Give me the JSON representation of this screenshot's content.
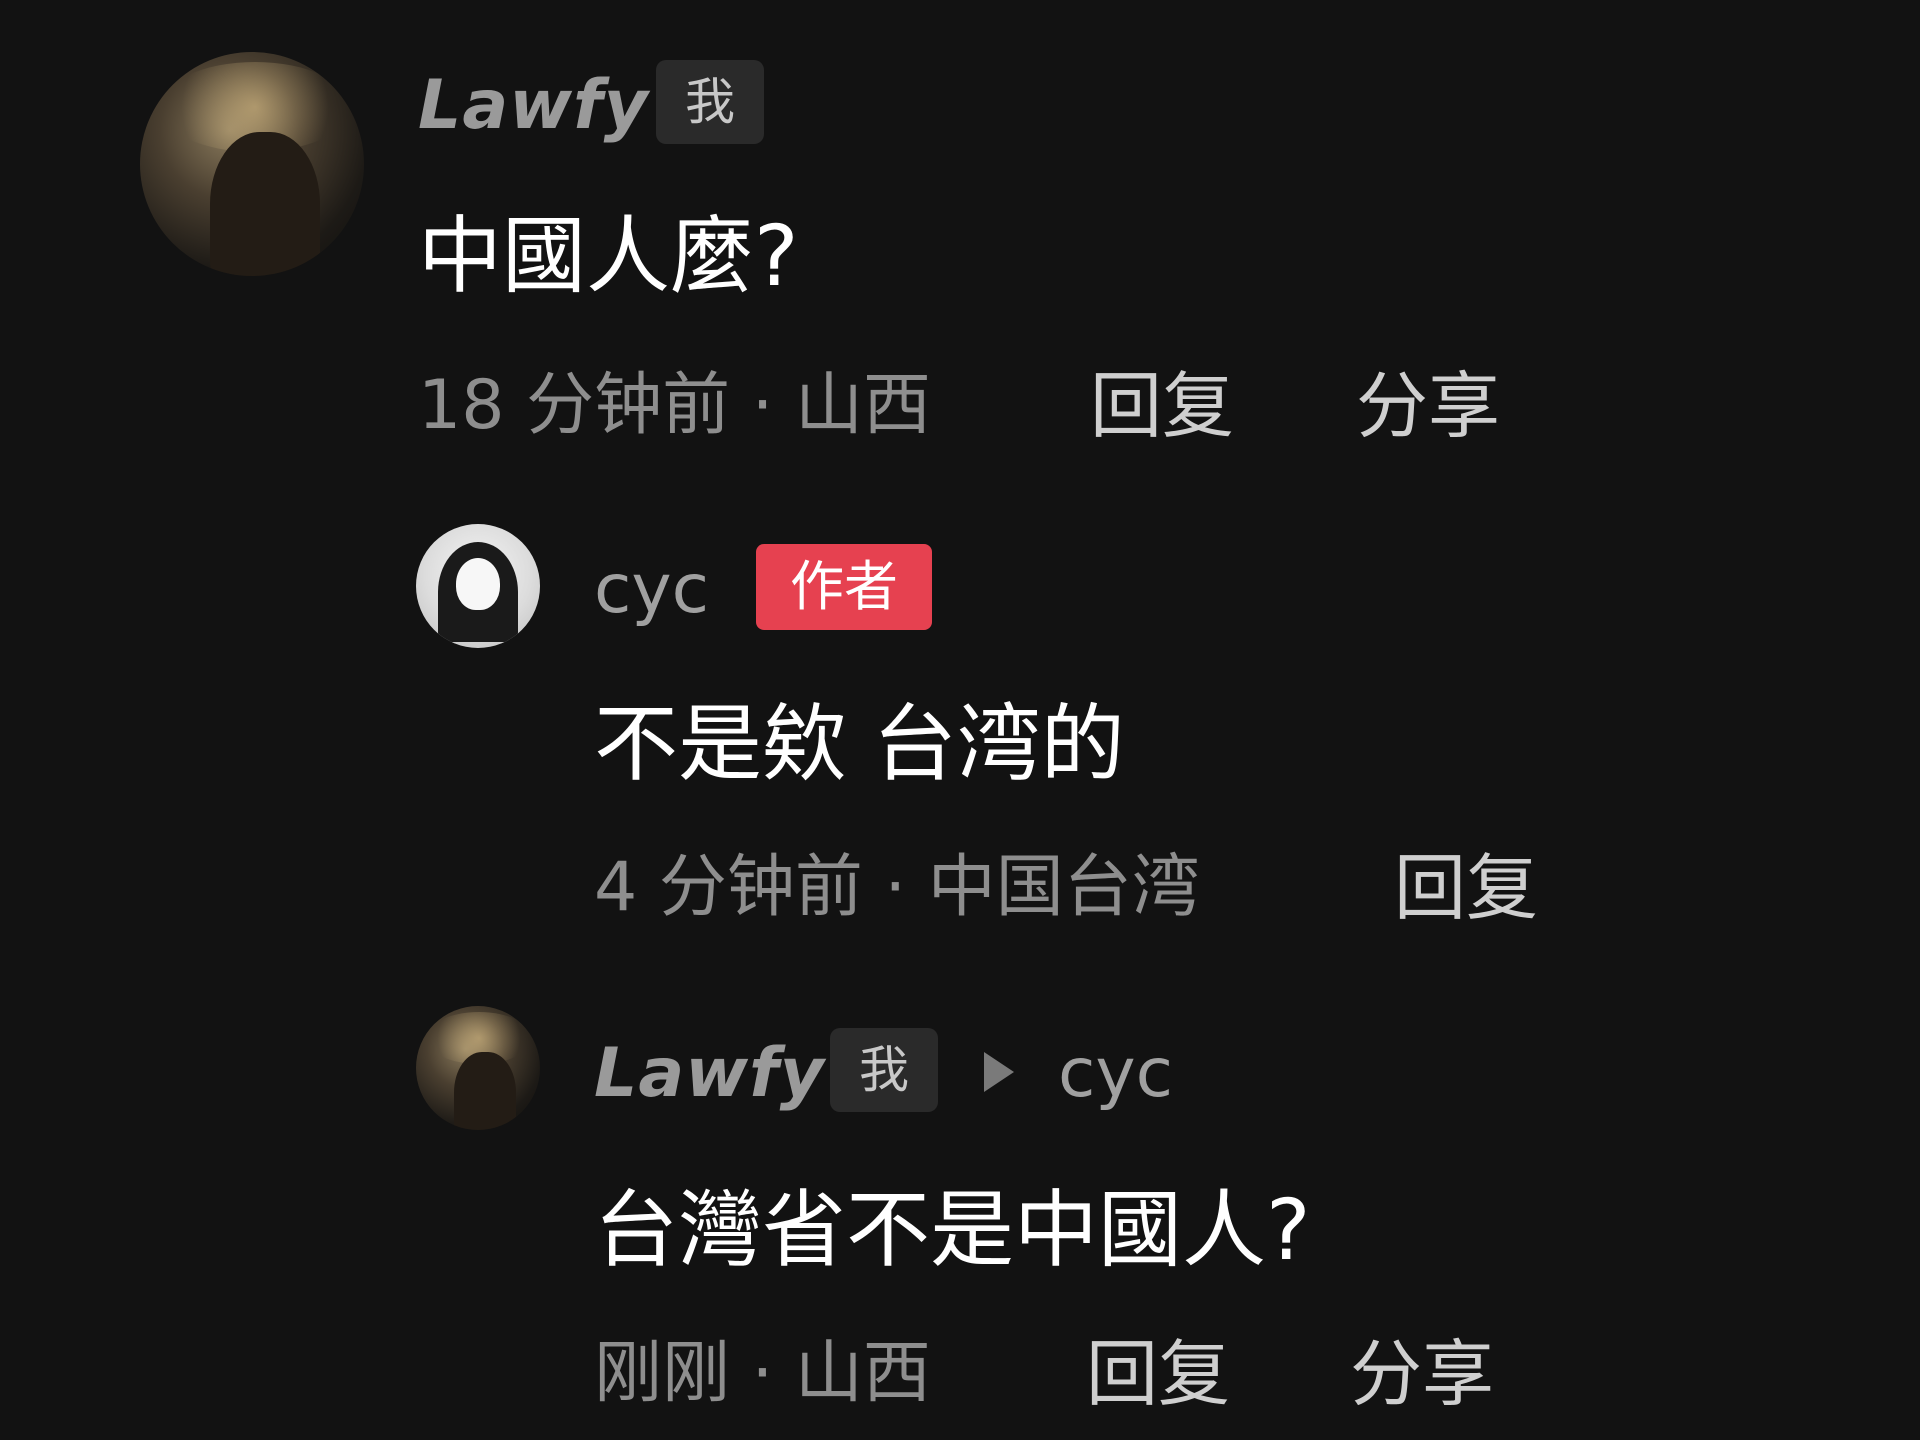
{
  "comments": [
    {
      "username": "Lawfy",
      "badge": "我",
      "text": "中國人麼?",
      "meta": "18 分钟前 · 山西",
      "reply_label": "回复",
      "share_label": "分享"
    },
    {
      "username": "cyc",
      "badge": "作者",
      "text": "不是欸 台湾的",
      "meta": "4 分钟前 · 中国台湾",
      "reply_label": "回复"
    },
    {
      "username": "Lawfy",
      "badge": "我",
      "reply_to": "cyc",
      "text": "台灣省不是中國人?",
      "meta": "刚刚 · 山西",
      "reply_label": "回复",
      "share_label": "分享"
    }
  ],
  "colors": {
    "background": "#121212",
    "author_badge": "#e64150",
    "text_primary": "#ffffff",
    "text_secondary": "#8e8e8e"
  }
}
